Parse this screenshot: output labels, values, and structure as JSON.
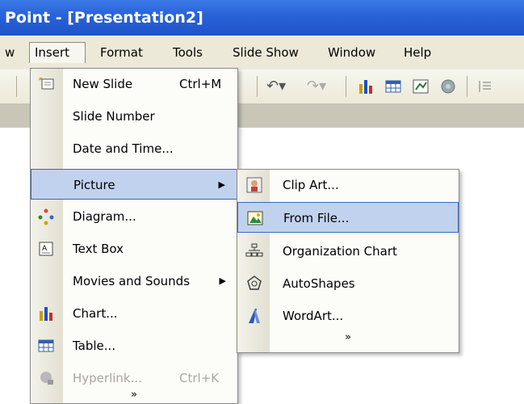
{
  "window": {
    "title": "Point - [Presentation2]"
  },
  "menubar": {
    "items": [
      {
        "label": "w"
      },
      {
        "label": "Insert"
      },
      {
        "label": "Format"
      },
      {
        "label": "Tools"
      },
      {
        "label": "Slide Show"
      },
      {
        "label": "Window"
      },
      {
        "label": "Help"
      }
    ]
  },
  "insert_menu": {
    "items": [
      {
        "label": "New Slide",
        "shortcut": "Ctrl+M",
        "icon": "new-slide-icon"
      },
      {
        "label": "Slide Number"
      },
      {
        "label": "Date and Time..."
      },
      {
        "label": "Picture",
        "submenu": true
      },
      {
        "label": "Diagram...",
        "icon": "diagram-icon"
      },
      {
        "label": "Text Box",
        "icon": "text-box-icon"
      },
      {
        "label": "Movies and Sounds",
        "submenu": true
      },
      {
        "label": "Chart...",
        "icon": "chart-icon"
      },
      {
        "label": "Table...",
        "icon": "table-icon"
      },
      {
        "label": "Hyperlink...",
        "shortcut": "Ctrl+K",
        "icon": "hyperlink-icon",
        "disabled": true
      }
    ],
    "more": "»"
  },
  "picture_submenu": {
    "items": [
      {
        "label": "Clip Art...",
        "icon": "clip-art-icon"
      },
      {
        "label": "From File...",
        "icon": "picture-file-icon"
      },
      {
        "label": "Organization Chart",
        "icon": "org-chart-icon"
      },
      {
        "label": "AutoShapes",
        "icon": "autoshapes-icon"
      },
      {
        "label": "WordArt...",
        "icon": "wordart-icon"
      }
    ],
    "more": "»"
  },
  "colors": {
    "titlebar": "#2a63d8",
    "menubar": "#ece9d8",
    "highlight_bg": "#c1d2ee",
    "highlight_border": "#316ac5"
  }
}
